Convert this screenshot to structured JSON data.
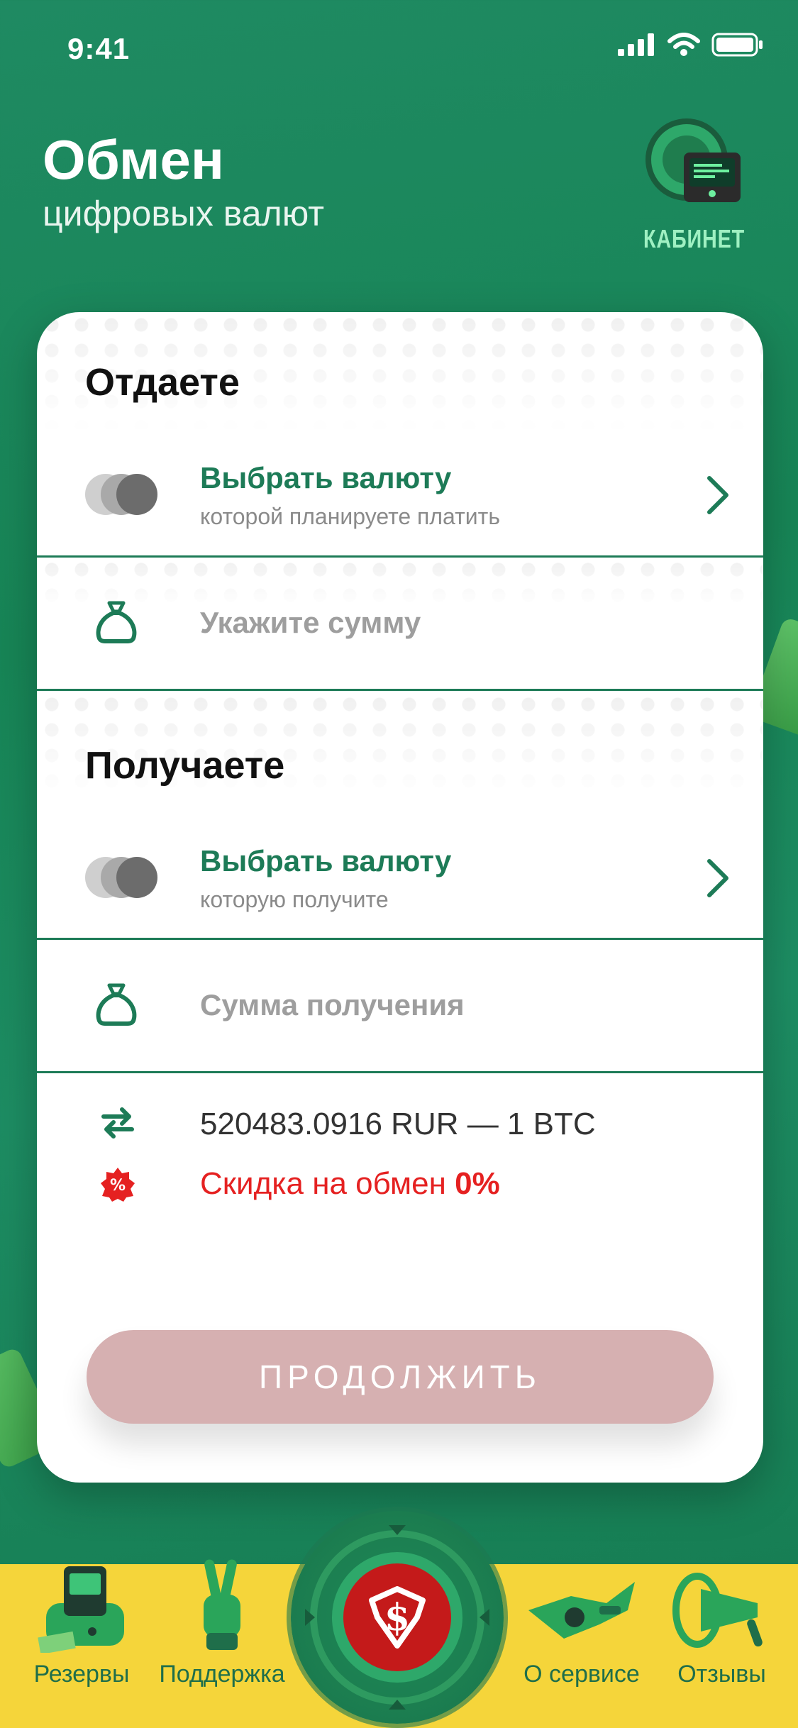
{
  "status_bar": {
    "time": "9:41"
  },
  "header": {
    "title": "Обмен",
    "subtitle": "цифровых валют",
    "cabinet_label": "КАБИНЕТ"
  },
  "give": {
    "section_title": "Отдаете",
    "currency_title": "Выбрать валюту",
    "currency_subtitle": "которой планируете платить",
    "amount_placeholder": "Укажите сумму"
  },
  "receive": {
    "section_title": "Получаете",
    "currency_title": "Выбрать валюту",
    "currency_subtitle": "которую получите",
    "amount_placeholder": "Сумма получения"
  },
  "rate_text": "520483.0916 RUR — 1 BTC",
  "discount": {
    "label": "Скидка на обмен",
    "value": "0%"
  },
  "continue_button": "ПРОДОЛЖИТЬ",
  "colors": {
    "primary": "#1d7b57",
    "accent_red": "#e52121",
    "nav_bg": "#f5d53a",
    "button_disabled": "#d6b0b1"
  },
  "nav": {
    "items": [
      {
        "label": "Резервы",
        "icon": "printer-icon"
      },
      {
        "label": "Поддержка",
        "icon": "victory-hand-icon"
      },
      {
        "label": "",
        "icon": "superman-dollar-icon"
      },
      {
        "label": "О сервисе",
        "icon": "gadget-icon"
      },
      {
        "label": "Отзывы",
        "icon": "megaphone-icon"
      }
    ]
  }
}
